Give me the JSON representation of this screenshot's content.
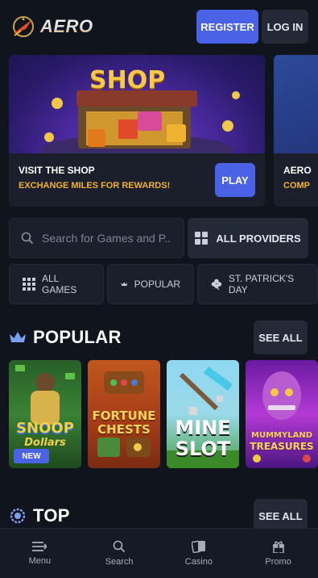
{
  "header": {
    "logo_text": "AERO",
    "register_label": "REGISTER",
    "login_label": "LOG IN"
  },
  "promos": [
    {
      "art_text": "SHOP",
      "title": "VISIT THE SHOP",
      "subtitle": "EXCHANGE MILES FOR REWARDS!",
      "button_label": "PLAY"
    },
    {
      "title": "AERO",
      "subtitle": "COMP"
    }
  ],
  "search": {
    "placeholder": "Search for Games and P...",
    "providers_label": "ALL PROVIDERS"
  },
  "categories": [
    {
      "label": "ALL GAMES",
      "icon": "grid-icon"
    },
    {
      "label": "POPULAR",
      "icon": "crown-icon"
    },
    {
      "label": "ST. PATRICK'S DAY",
      "icon": "clover-icon"
    }
  ],
  "sections": {
    "popular": {
      "title": "POPULAR",
      "see_all_label": "SEE ALL",
      "games": [
        {
          "name_line1": "SNOOP",
          "name_line2": "Dollars",
          "badge": "NEW"
        },
        {
          "name_line1": "FORTUNE",
          "name_line2": "CHESTS"
        },
        {
          "name_line1": "MINE",
          "name_line2": "SLOT"
        },
        {
          "name_line1": "MUMMYLAND",
          "name_line2": "TREASURES"
        }
      ]
    },
    "top": {
      "title": "TOP",
      "see_all_label": "SEE ALL"
    }
  },
  "bottom_nav": [
    {
      "label": "Menu",
      "icon": "menu-icon"
    },
    {
      "label": "Search",
      "icon": "search-icon"
    },
    {
      "label": "Casino",
      "icon": "cards-icon"
    },
    {
      "label": "Promo",
      "icon": "gift-icon"
    }
  ],
  "colors": {
    "background": "#10141d",
    "accent": "#4a63e6",
    "highlight": "#f2b231",
    "surface": "#1b1f2b"
  }
}
